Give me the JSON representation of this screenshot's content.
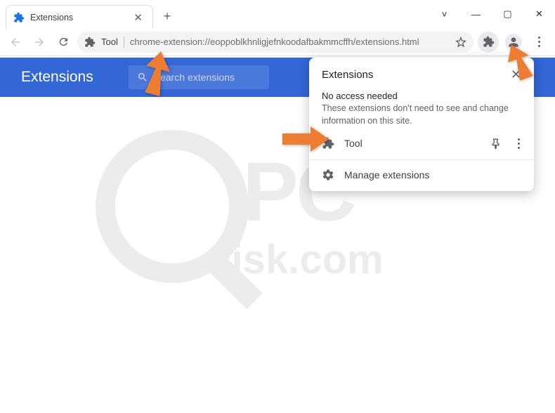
{
  "window_controls": {
    "chevron": "˅",
    "minimize": "—",
    "maximize": "▢",
    "close": "✕"
  },
  "tab": {
    "title": "Extensions"
  },
  "omnibox": {
    "prefix": "Tool",
    "url": "chrome-extension://eoppoblkhnligjefnkoodafbakmmcffh/extensions.html"
  },
  "page": {
    "title": "Extensions",
    "search_placeholder": "Search extensions"
  },
  "popup": {
    "title": "Extensions",
    "no_access_title": "No access needed",
    "no_access_desc": "These extensions don't need to see and change information on this site.",
    "items": [
      {
        "name": "Tool"
      }
    ],
    "manage_label": "Manage extensions"
  },
  "colors": {
    "blue": "#3367d6",
    "arrow": "#ed7d31"
  },
  "watermark": {
    "brand": "PC",
    "domain": "risk.com"
  }
}
